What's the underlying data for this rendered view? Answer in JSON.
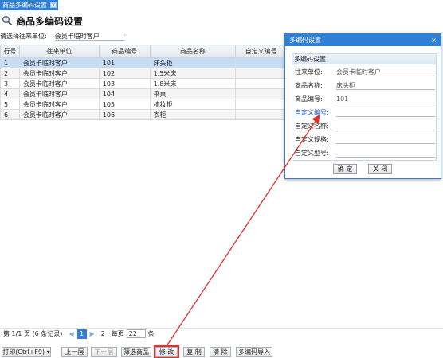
{
  "tab": {
    "label": "商品多编码设置"
  },
  "page": {
    "title": "商品多编码设置"
  },
  "filter": {
    "label": "请选择往来单位:",
    "value": "会员卡临时客户",
    "more": "···"
  },
  "grid": {
    "headers": [
      "行号",
      "往来单位",
      "商品编号",
      "商品名称",
      "自定义编号"
    ],
    "rows": [
      [
        "1",
        "会员卡临时客户",
        "101",
        "床头柜",
        ""
      ],
      [
        "2",
        "会员卡临时客户",
        "102",
        "1.5米床",
        ""
      ],
      [
        "3",
        "会员卡临时客户",
        "103",
        "1.8米床",
        ""
      ],
      [
        "4",
        "会员卡临时客户",
        "104",
        "书桌",
        ""
      ],
      [
        "5",
        "会员卡临时客户",
        "105",
        "梳妆柜",
        ""
      ],
      [
        "6",
        "会员卡临时客户",
        "106",
        "衣柜",
        ""
      ]
    ]
  },
  "dialog": {
    "title": "多编码设置",
    "close": "×",
    "section": "多编码设置",
    "fields": [
      {
        "label": "往来单位:",
        "value": "会员卡临时客户"
      },
      {
        "label": "商品名称:",
        "value": "床头柜"
      },
      {
        "label": "商品编号:",
        "value": "101"
      },
      {
        "label": "自定义编号:",
        "value": ""
      },
      {
        "label": "自定义名称:",
        "value": ""
      },
      {
        "label": "自定义规格:",
        "value": ""
      },
      {
        "label": "自定义型号:",
        "value": ""
      }
    ],
    "ok": "确 定",
    "cancel": "关 闭"
  },
  "pager": {
    "summary": "第 1/1 页 (6 条记录)",
    "current_page": "1",
    "next_page": "2",
    "per_page_label": "每页",
    "per_page": "22",
    "unit": "条"
  },
  "toolbar": {
    "print": "打印(Ctrl+F9) ▾",
    "prev_level": "上一层",
    "next_level": "下一层",
    "filter_goods": "筛选商品",
    "edit": "修 改",
    "copy": "复 制",
    "clear": "清 除",
    "import": "多编码导入"
  },
  "colors": {
    "accent": "#2f7fd5",
    "highlight": "#e0302b",
    "label_blue": "#1a52c4"
  }
}
